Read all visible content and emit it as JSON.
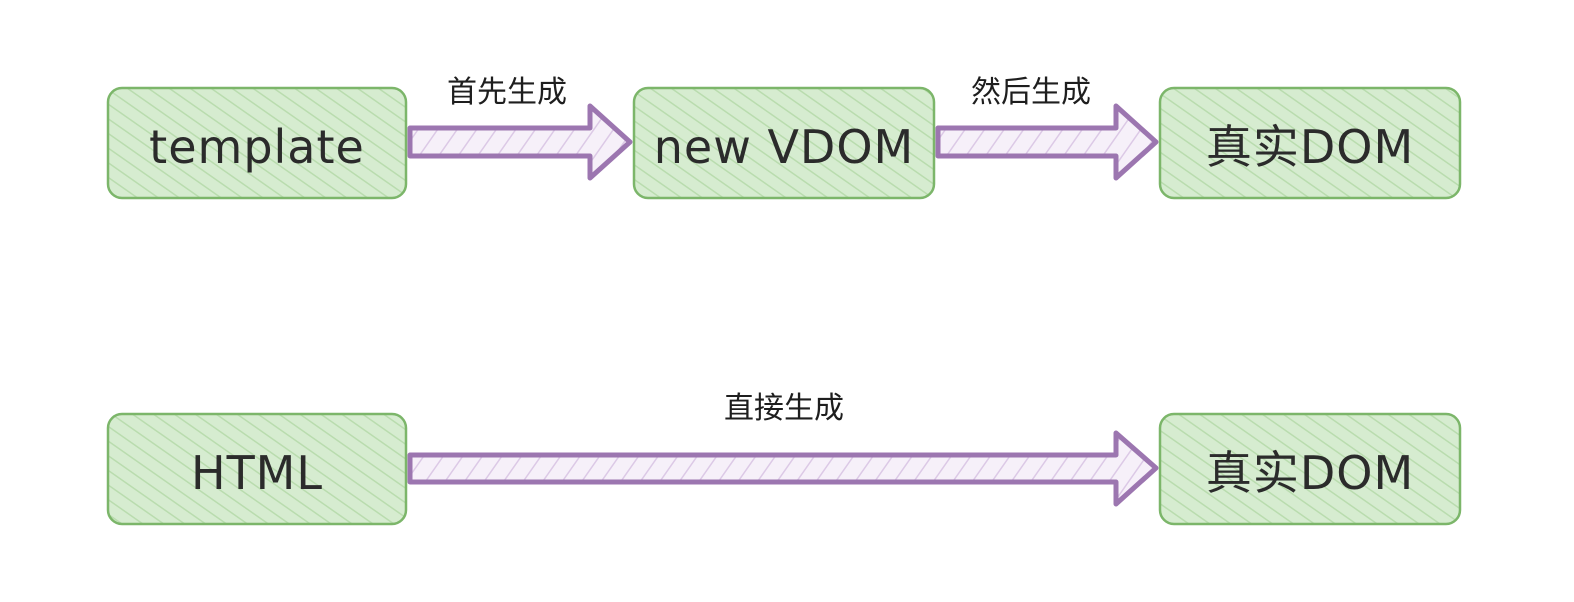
{
  "colors": {
    "node_fill": "#d6ecd0",
    "node_hatch": "#b9dcae",
    "node_stroke": "#7cb66a",
    "arrow_stroke": "#9c76b0",
    "arrow_hatch": "#dcc9e6"
  },
  "flows": [
    {
      "nodes": [
        {
          "label": "template"
        },
        {
          "label": "new VDOM"
        },
        {
          "label": "真实DOM"
        }
      ],
      "edges": [
        {
          "label": "首先生成"
        },
        {
          "label": "然后生成"
        }
      ]
    },
    {
      "nodes": [
        {
          "label": "HTML"
        },
        {
          "label": "真实DOM"
        }
      ],
      "edges": [
        {
          "label": "直接生成"
        }
      ]
    }
  ]
}
